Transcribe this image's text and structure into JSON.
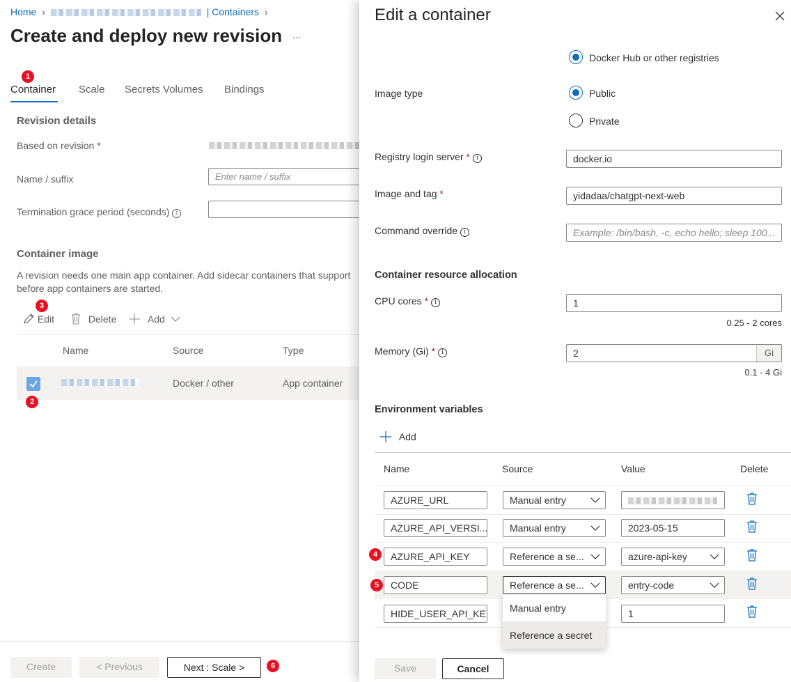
{
  "left": {
    "breadcrumb": {
      "home": "Home",
      "containers": "| Containers"
    },
    "title": "Create and deploy new revision",
    "more": "...",
    "tabs": [
      "Container",
      "Scale",
      "Secrets Volumes",
      "Bindings"
    ],
    "revision_details": {
      "heading": "Revision details",
      "based_on_label": "Based on revision",
      "name_suffix_label": "Name / suffix",
      "name_suffix_placeholder": "Enter name / suffix",
      "termination_label": "Termination grace period (seconds)"
    },
    "container_image": {
      "heading": "Container image",
      "description": "A revision needs one main app container. Add sidecar containers that support before app containers are started.",
      "toolbar": {
        "edit": "Edit",
        "delete": "Delete",
        "add": "Add"
      },
      "columns": [
        "Name",
        "Source",
        "Type"
      ],
      "row": {
        "source": "Docker / other",
        "type": "App container"
      }
    },
    "footer": {
      "create": "Create",
      "previous": "< Previous",
      "next": "Next : Scale >"
    },
    "badges": [
      "1",
      "2",
      "3",
      "6"
    ]
  },
  "panel": {
    "title": "Edit a container",
    "registry_option": "Docker Hub or other registries",
    "image_type_label": "Image type",
    "public": "Public",
    "private": "Private",
    "registry_login_label": "Registry login server",
    "registry_login_value": "docker.io",
    "image_tag_label": "Image and tag",
    "image_tag_value": "yidadaa/chatgpt-next-web",
    "command_label": "Command override",
    "command_placeholder": "Example: /bin/bash, -c, echo hello; sleep 100...",
    "resource_heading": "Container resource allocation",
    "cpu_label": "CPU cores",
    "cpu_value": "1",
    "cpu_range": "0.25 - 2 cores",
    "memory_label": "Memory (Gi)",
    "memory_value": "2",
    "memory_unit": "Gi",
    "memory_range": "0.1 - 4 Gi",
    "env_heading": "Environment variables",
    "env_add": "Add",
    "env_columns": [
      "Name",
      "Source",
      "Value",
      "Delete"
    ],
    "env_rows": [
      {
        "name": "AZURE_URL",
        "source": "Manual entry",
        "value": ""
      },
      {
        "name": "AZURE_API_VERSI...",
        "source": "Manual entry",
        "value": "2023-05-15"
      },
      {
        "name": "AZURE_API_KEY",
        "source": "Reference a se...",
        "value": "azure-api-key"
      },
      {
        "name": "CODE",
        "source": "Reference a se...",
        "value": "entry-code"
      },
      {
        "name": "HIDE_USER_API_KEY",
        "source": "",
        "value": "1"
      }
    ],
    "dropdown_options": [
      "Manual entry",
      "Reference a secret"
    ],
    "badges": [
      "4",
      "5"
    ],
    "save": "Save",
    "cancel": "Cancel"
  }
}
